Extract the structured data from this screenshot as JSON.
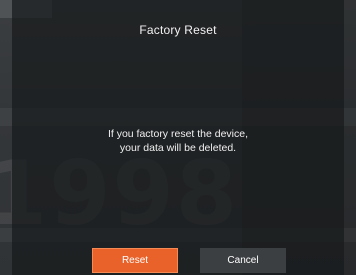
{
  "dialog": {
    "title": "Factory Reset",
    "message_line1": "If you factory reset the device,",
    "message_line2": "your data will be deleted.",
    "reset_label": "Reset",
    "cancel_label": "Cancel"
  },
  "background": {
    "number_text": "1998"
  },
  "colors": {
    "accent": "#e8622a",
    "dialog_bg": "#1e2022",
    "cancel_bg": "#3c3f42"
  }
}
